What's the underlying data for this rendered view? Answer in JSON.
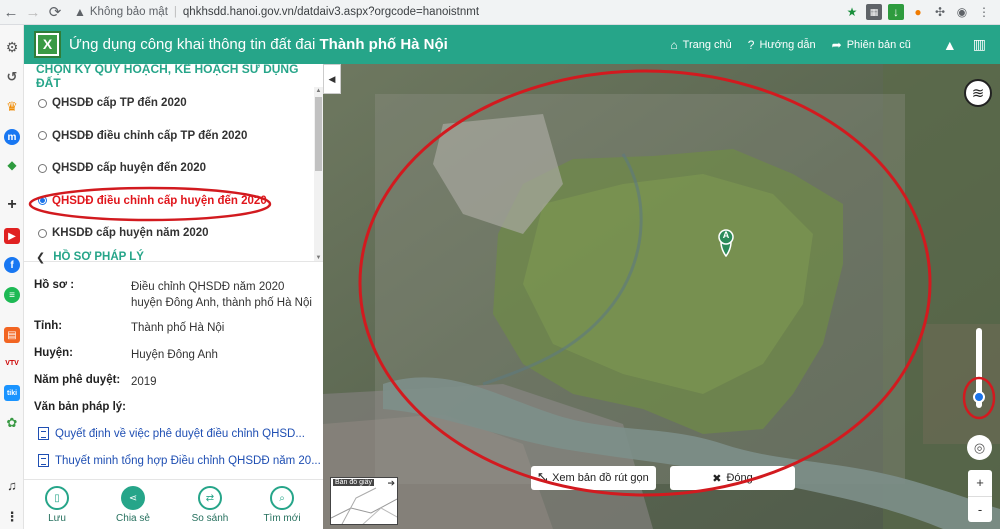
{
  "browser": {
    "security_label": "Không bảo mật",
    "url": "qhkhsdd.hanoi.gov.vn/datdaiv3.aspx?orgcode=hanoistnmt"
  },
  "app": {
    "title_prefix": "Ứng dụng công khai thông tin đất đai",
    "title_city": "Thành phố Hà Nội",
    "nav": {
      "home": "Trang chủ",
      "guide": "Hướng dẫn",
      "old_version": "Phiên bản cũ"
    }
  },
  "plan_panel": {
    "heading": "CHỌN KỲ QUY HOẠCH, KẾ HOẠCH SỬ DỤNG ĐẤT",
    "options": [
      {
        "label": "QHSDĐ cấp TP đến 2020",
        "selected": false
      },
      {
        "label": "QHSDĐ điều chỉnh cấp TP đến 2020",
        "selected": false
      },
      {
        "label": "QHSDĐ cấp huyện đến 2020",
        "selected": false
      },
      {
        "label": "QHSDĐ điều chỉnh cấp huyện đến 2020",
        "selected": true
      },
      {
        "label": "KHSDĐ cấp huyện năm 2020",
        "selected": false
      }
    ]
  },
  "legal": {
    "heading": "HỒ SƠ PHÁP LÝ",
    "ho_so_label": "Hồ sơ :",
    "ho_so_value": "Điều chỉnh QHSDĐ năm 2020 huyện Đông Anh, thành phố Hà Nội",
    "tinh_label": "Tỉnh:",
    "tinh_value": "Thành phố Hà Nội",
    "huyen_label": "Huyện:",
    "huyen_value": "Huyện Đông Anh",
    "nam_label": "Năm phê duyệt:",
    "nam_value": "2019",
    "vanban_label": "Văn bản pháp lý:",
    "documents": [
      "Quyết định về việc phê duyệt điều chỉnh QHSD...",
      "Thuyết minh tổng hợp Điều chỉnh QHSDĐ năm 20..."
    ]
  },
  "bottom_actions": {
    "save": "Lưu",
    "share": "Chia sẻ",
    "compare": "So sánh",
    "search_new": "Tìm mới"
  },
  "map": {
    "compact_button": "Xem bản đồ rút gọn",
    "close_button": "Đóng",
    "minimap_label": "Bản đồ giấy",
    "marker_label": "A",
    "zoom_in": "+",
    "zoom_out": "-",
    "zoom_level": 0.18,
    "annotation_color": "#d21a1f"
  }
}
